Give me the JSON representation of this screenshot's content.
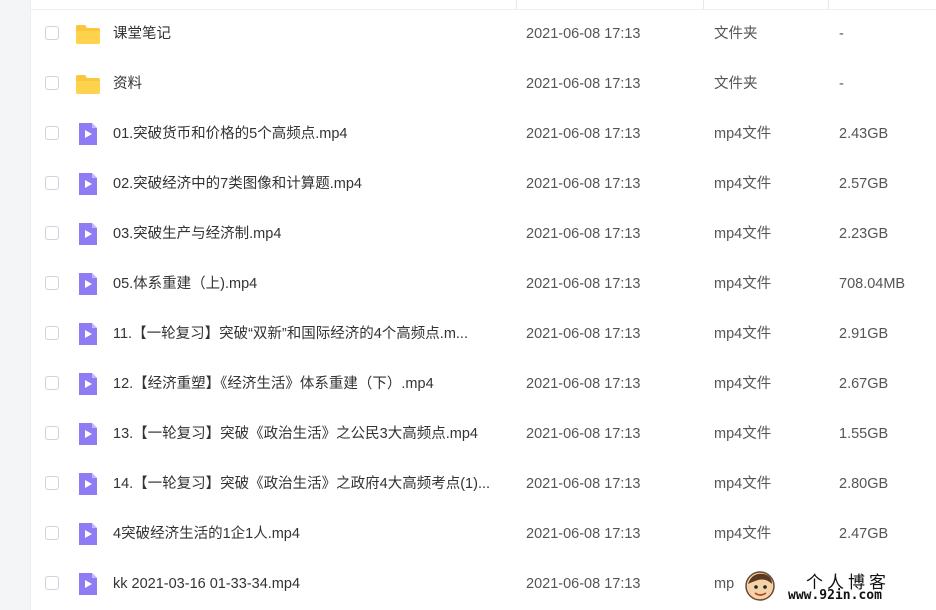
{
  "files": [
    {
      "icon": "folder-icon",
      "name": "课堂笔记",
      "date": "2021-06-08 17:13",
      "type": "文件夹",
      "size": "-"
    },
    {
      "icon": "folder-icon",
      "name": "资料",
      "date": "2021-06-08 17:13",
      "type": "文件夹",
      "size": "-"
    },
    {
      "icon": "video-file-icon",
      "name": "01.突破货币和价格的5个高频点.mp4",
      "date": "2021-06-08 17:13",
      "type": "mp4文件",
      "size": "2.43GB"
    },
    {
      "icon": "video-file-icon",
      "name": "02.突破经济中的7类图像和计算题.mp4",
      "date": "2021-06-08 17:13",
      "type": "mp4文件",
      "size": "2.57GB"
    },
    {
      "icon": "video-file-icon",
      "name": "03.突破生产与经济制.mp4",
      "date": "2021-06-08 17:13",
      "type": "mp4文件",
      "size": "2.23GB"
    },
    {
      "icon": "video-file-icon",
      "name": "05.体系重建（上).mp4",
      "date": "2021-06-08 17:13",
      "type": "mp4文件",
      "size": "708.04MB"
    },
    {
      "icon": "video-file-icon",
      "name": "11.【一轮复习】突破“双新”和国际经济的4个高频点.m...",
      "date": "2021-06-08 17:13",
      "type": "mp4文件",
      "size": "2.91GB"
    },
    {
      "icon": "video-file-icon",
      "name": "12.【经济重塑】《经济生活》体系重建（下）.mp4",
      "date": "2021-06-08 17:13",
      "type": "mp4文件",
      "size": "2.67GB"
    },
    {
      "icon": "video-file-icon",
      "name": "13.【一轮复习】突破《政治生活》之公民3大高频点.mp4",
      "date": "2021-06-08 17:13",
      "type": "mp4文件",
      "size": "1.55GB"
    },
    {
      "icon": "video-file-icon",
      "name": "14.【一轮复习】突破《政治生活》之政府4大高频考点(1)...",
      "date": "2021-06-08 17:13",
      "type": "mp4文件",
      "size": "2.80GB"
    },
    {
      "icon": "video-file-icon",
      "name": "4突破经济生活的1企1人.mp4",
      "date": "2021-06-08 17:13",
      "type": "mp4文件",
      "size": "2.47GB"
    },
    {
      "icon": "video-file-icon",
      "name": "kk 2021-03-16 01-33-34.mp4",
      "date": "2021-06-08 17:13",
      "type": "mp",
      "size": ""
    }
  ],
  "watermark": {
    "title": "个人博客",
    "url": "www.92in.com"
  },
  "colors": {
    "folder": "#fcc63a",
    "video": "#8f7cf5",
    "text": "#333333"
  }
}
